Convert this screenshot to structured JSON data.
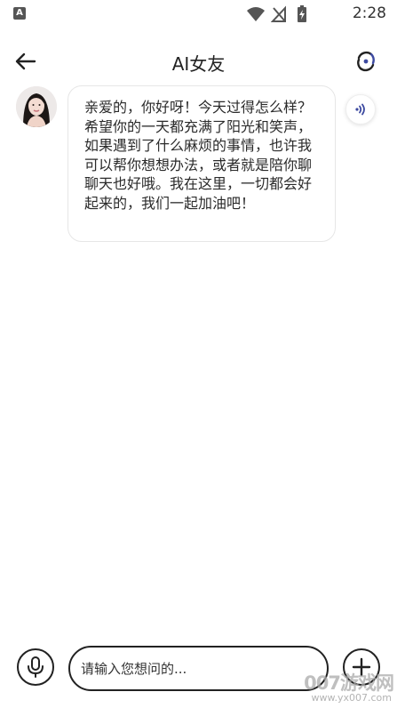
{
  "status_bar": {
    "time": "2:28",
    "left_icon": "A",
    "icons": [
      "wifi-icon",
      "signal-icon",
      "battery-charging-icon"
    ]
  },
  "header": {
    "title": "AI女友",
    "back_icon": "arrow-left-icon",
    "refresh_icon": "refresh-icon"
  },
  "chat": {
    "messages": [
      {
        "sender": "ai",
        "avatar_icon": "avatar",
        "text": "亲爱的，你好呀！今天过得怎么样？希望你的一天都充满了阳光和笑声，如果遇到了什么麻烦的事情，也许我可以帮你想想办法，或者就是陪你聊聊天也好哦。我在这里，一切都会好起来的，我们一起加油吧！",
        "voice_icon": "speaker-icon"
      }
    ]
  },
  "input_bar": {
    "placeholder": "请输入您想问的...",
    "value": "",
    "mic_icon": "microphone-icon",
    "add_icon": "plus-icon"
  },
  "watermark": {
    "brand": "007游戏网",
    "url": "www.yx007.com"
  },
  "colors": {
    "text": "#222222",
    "bubble_border": "#e6e6e6",
    "accent": "#3d4aa0"
  }
}
